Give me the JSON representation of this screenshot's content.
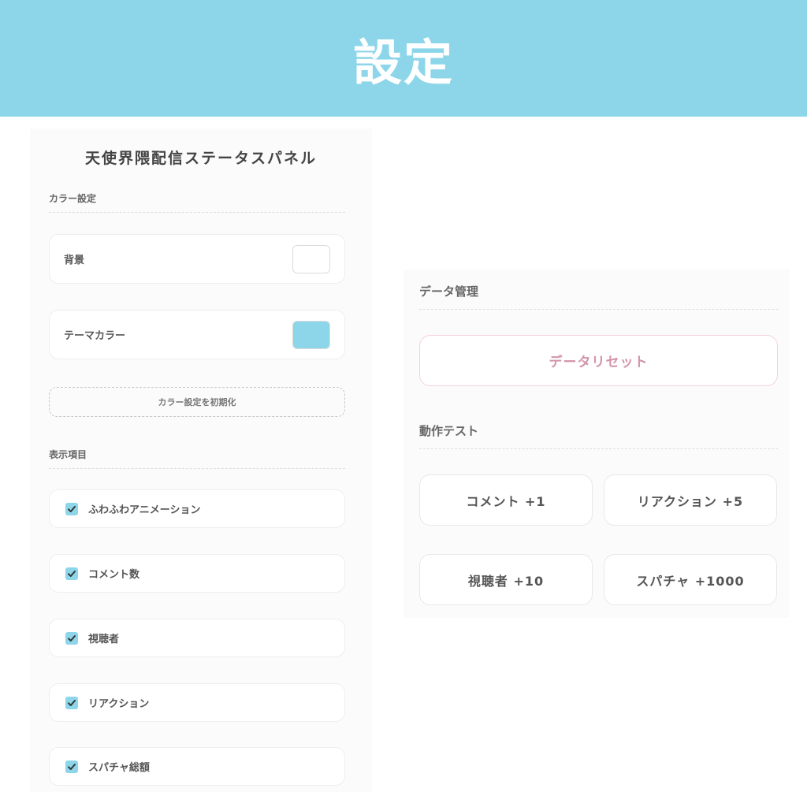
{
  "header": {
    "title": "設定"
  },
  "panel": {
    "title": "天使界隈配信ステータスパネル",
    "color_section": {
      "label": "カラー設定",
      "background": {
        "label": "背景",
        "color": "#ffffff"
      },
      "theme": {
        "label": "テーマカラー",
        "color": "#8dd6ea"
      },
      "reset_label": "カラー設定を初期化"
    },
    "display_section": {
      "label": "表示項目",
      "items": [
        {
          "label": "ふわふわアニメーション",
          "checked": true
        },
        {
          "label": "コメント数",
          "checked": true
        },
        {
          "label": "視聴者",
          "checked": true
        },
        {
          "label": "リアクション",
          "checked": true
        },
        {
          "label": "スパチャ総額",
          "checked": true
        }
      ]
    }
  },
  "data_section": {
    "label": "データ管理",
    "reset_label": "データリセット"
  },
  "test_section": {
    "label": "動作テスト",
    "buttons": [
      {
        "label": "コメント +1"
      },
      {
        "label": "リアクション +5"
      },
      {
        "label": "視聴者 +10"
      },
      {
        "label": "スパチャ +1000"
      }
    ]
  },
  "colors": {
    "accent": "#8dd6ea",
    "danger_text": "#d494a8",
    "danger_border": "#f4d2da"
  }
}
